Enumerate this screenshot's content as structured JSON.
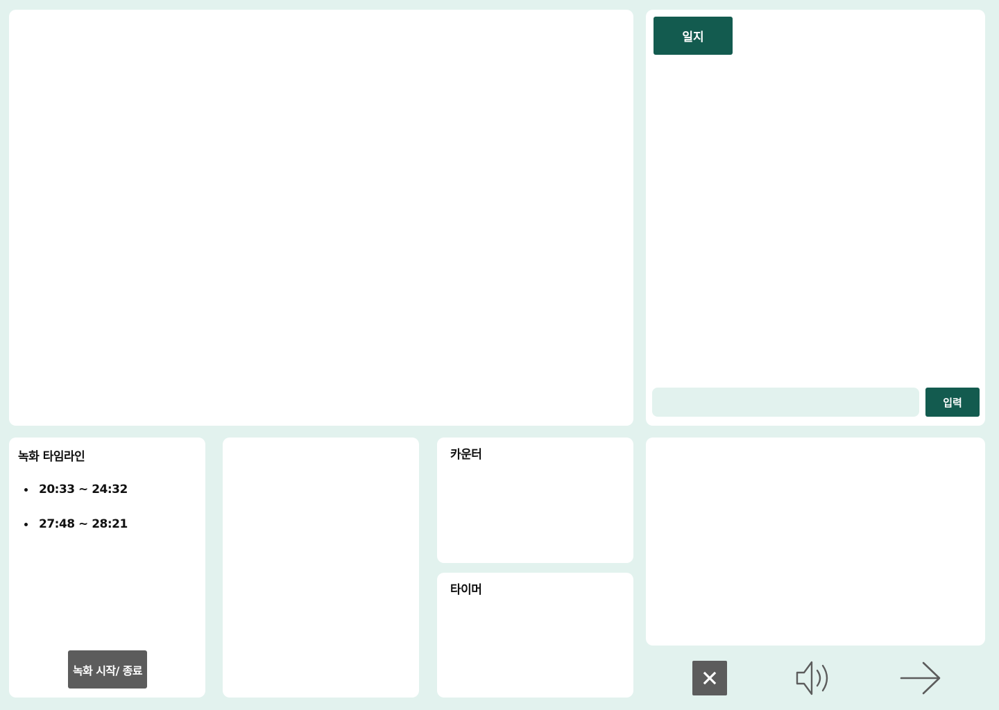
{
  "log": {
    "tab_label": "일지",
    "input_value": "",
    "input_placeholder": "",
    "submit_label": "입력"
  },
  "timeline": {
    "title": "녹화 타임라인",
    "items": [
      "20:33 ~ 24:32",
      "27:48 ~ 28:21"
    ],
    "record_button_label": "녹화 시작/ 종료"
  },
  "counter": {
    "title": "카운터"
  },
  "timer": {
    "title": "타이머"
  },
  "controls": {
    "close_icon": "close-icon",
    "volume_icon": "volume-icon",
    "next_icon": "arrow-right-icon"
  },
  "colors": {
    "background": "#E2F2EE",
    "accent": "#135B4F",
    "neutral_button": "#5C5C5C",
    "panel": "#FFFFFF"
  }
}
